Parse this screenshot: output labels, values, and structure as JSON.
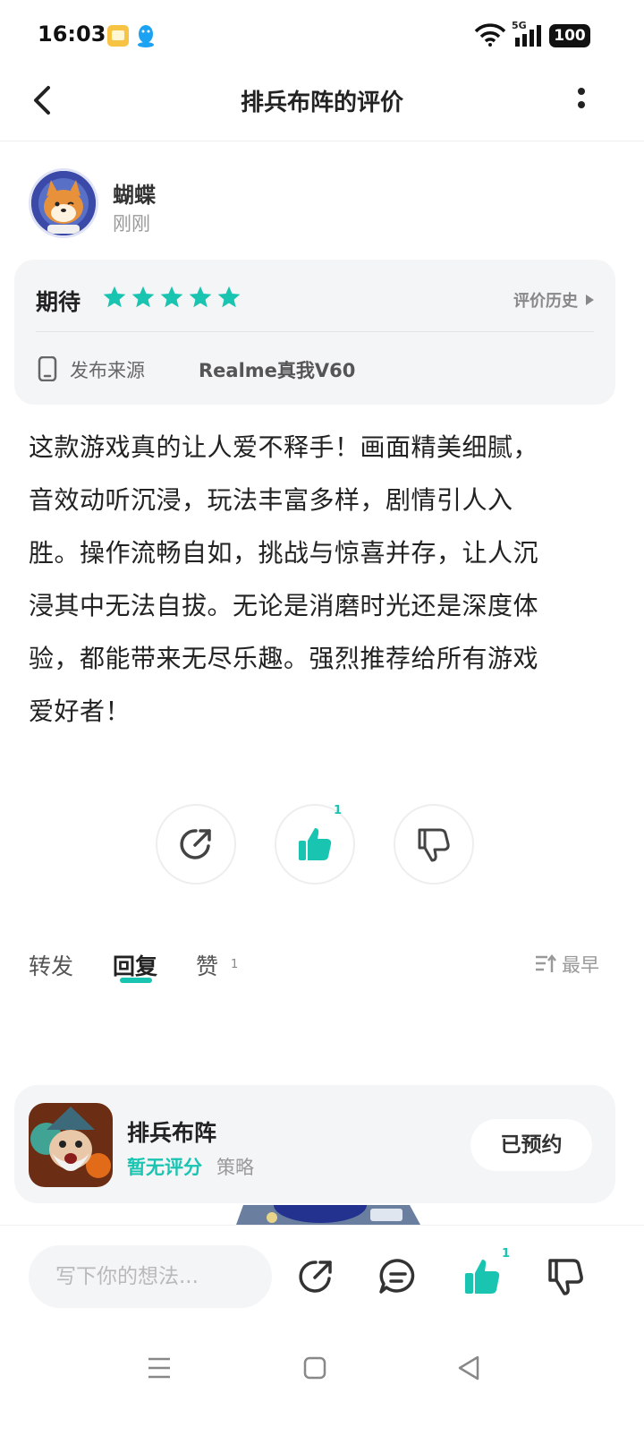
{
  "status_bar": {
    "time": "16:03",
    "network": "5G",
    "battery": "100"
  },
  "header": {
    "title": "排兵布阵的评价"
  },
  "reviewer": {
    "name": "蝴蝶",
    "time": "刚刚"
  },
  "rating": {
    "label": "期待",
    "stars": 5,
    "star_color": "#19c4b1",
    "history_label": "评价历史",
    "source_label": "发布来源",
    "source_value": "Realme真我V60"
  },
  "review": {
    "lines": [
      "这款游戏真的让人爱不释手！画面精美细腻，",
      "音效动听沉浸，玩法丰富多样，剧情引人入",
      "胜。操作流畅自如，挑战与惊喜并存，让人沉",
      "浸其中无法自拔。无论是消磨时光还是深度体",
      "验，都能带来无尽乐趣。强烈推荐给所有游戏",
      "爱好者！"
    ]
  },
  "actions": {
    "like_count": "1"
  },
  "tabs": {
    "forward": "转发",
    "reply": "回复",
    "likes": "赞",
    "likes_count": "1",
    "sort": "最早"
  },
  "game": {
    "name": "排兵布阵",
    "score": "暂无评分",
    "genre": "策略",
    "button": "已预约"
  },
  "bottom_bar": {
    "input_placeholder": "写下你的想法...",
    "like_count": "1"
  },
  "icons": {
    "back": "chevron-left-icon",
    "more": "more-vertical-icon",
    "share": "share-icon",
    "like": "thumbs-up-icon",
    "dislike": "thumbs-down-icon",
    "comment": "comment-icon",
    "sort": "sort-icon",
    "device": "phone-icon"
  },
  "colors": {
    "accent": "#19c4b1",
    "card_bg": "#f4f5f7"
  }
}
